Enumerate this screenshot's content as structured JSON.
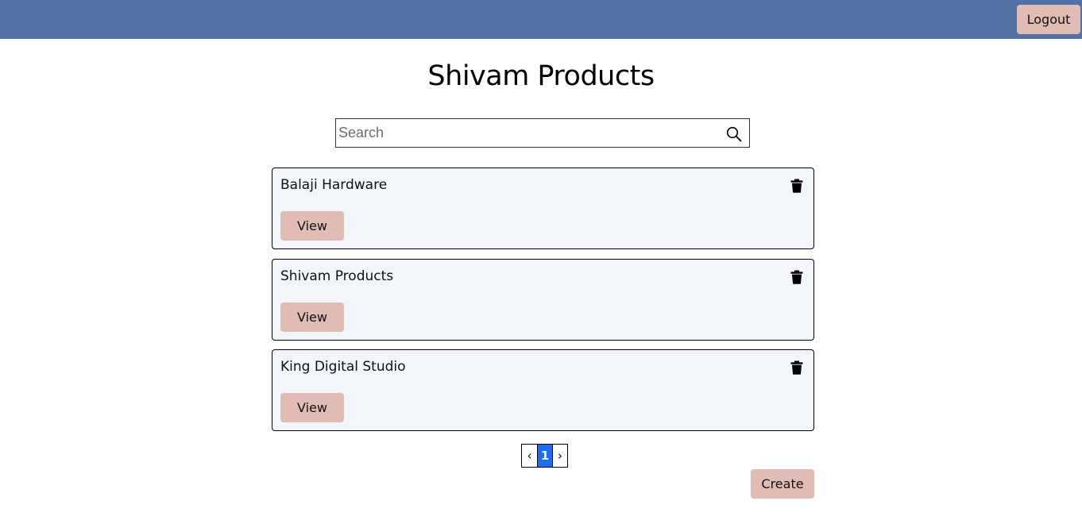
{
  "header": {
    "logout_label": "Logout",
    "background_color": "#5272a6"
  },
  "page": {
    "title": "Shivam Products"
  },
  "search": {
    "placeholder": "Search",
    "value": "",
    "icon": "search-icon"
  },
  "stores": [
    {
      "name": "Balaji Hardware",
      "view_label": "View",
      "delete_icon": "trash-icon"
    },
    {
      "name": "Shivam Products",
      "view_label": "View",
      "delete_icon": "trash-icon"
    },
    {
      "name": "King Digital Studio",
      "view_label": "View",
      "delete_icon": "trash-icon"
    }
  ],
  "pagination": {
    "prev": "‹",
    "current_page": "1",
    "next": "›",
    "active_color": "#1b6ef3"
  },
  "actions": {
    "create_label": "Create",
    "button_color": "#e0bcb4"
  }
}
